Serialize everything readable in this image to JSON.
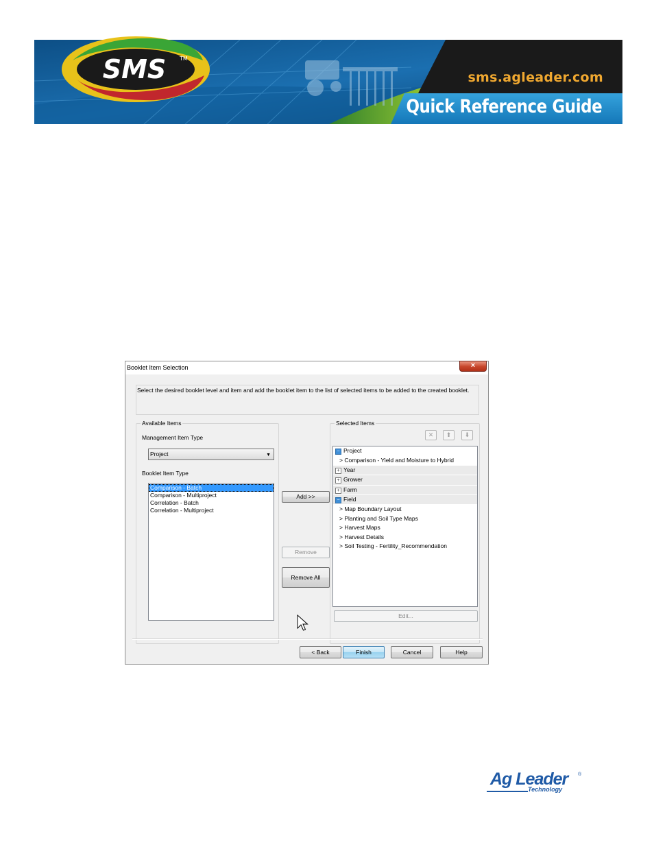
{
  "banner": {
    "logo_text": "SMS",
    "trademark": "TM",
    "url": "sms.agleader.com",
    "guide_title": "Quick Reference Guide"
  },
  "dialog": {
    "title": "Booklet Item Selection",
    "close_glyph": "×",
    "instructions": "Select the desired booklet level and item and add the booklet item to the list of selected items to be added to the created booklet.",
    "available_items": {
      "group_label": "Available Items",
      "management_label": "Management Item Type",
      "management_value": "Project",
      "booklet_label": "Booklet Item Type",
      "booklet_items": [
        {
          "label": "Comparison - Batch",
          "selected": true
        },
        {
          "label": "Comparison - Multiproject",
          "selected": false
        },
        {
          "label": "Correlation - Batch",
          "selected": false
        },
        {
          "label": "Correlation - Multiproject",
          "selected": false
        }
      ]
    },
    "buttons": {
      "add": "Add >>",
      "remove": "Remove",
      "remove_all": "Remove All",
      "edit": "Edit...",
      "back": "< Back",
      "finish": "Finish",
      "cancel": "Cancel",
      "help": "Help"
    },
    "toolbar_icons": [
      "delete-icon",
      "arrow-up-icon",
      "arrow-down-icon"
    ],
    "selected_items": {
      "group_label": "Selected Items",
      "tree": [
        {
          "type": "group",
          "label": "Project",
          "expanded": true
        },
        {
          "type": "child",
          "label": "> Comparison - Yield and Moisture to Hybrid"
        },
        {
          "type": "group",
          "label": "Year",
          "expanded": false
        },
        {
          "type": "group",
          "label": "Grower",
          "expanded": false
        },
        {
          "type": "group",
          "label": "Farm",
          "expanded": false
        },
        {
          "type": "group",
          "label": "Field",
          "expanded": true
        },
        {
          "type": "child",
          "label": "> Map Boundary Layout"
        },
        {
          "type": "child",
          "label": "> Planting and Soil Type Maps"
        },
        {
          "type": "child",
          "label": "> Harvest Maps"
        },
        {
          "type": "child",
          "label": "> Harvest Details"
        },
        {
          "type": "child",
          "label": "> Soil Testing - Fertility_Recommendation"
        }
      ]
    }
  },
  "footer_logo": {
    "name": "Ag Leader",
    "registered": "®",
    "sub": "Technology"
  },
  "colors": {
    "banner_dark": "#1a1a1a",
    "banner_blue": "#1e88c8",
    "url_orange": "#f0a830",
    "selection_blue": "#3399ff",
    "agleader_blue": "#1f5aa6"
  }
}
